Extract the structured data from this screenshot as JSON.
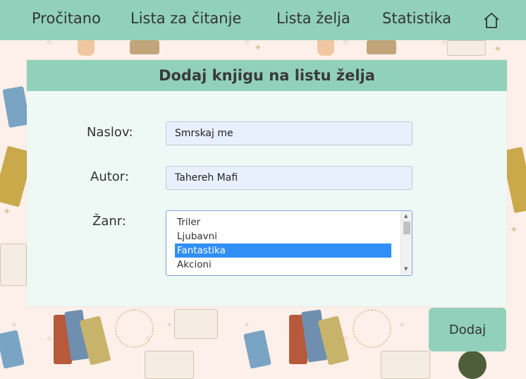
{
  "nav": {
    "items": [
      {
        "label": "Pročitano"
      },
      {
        "label": "Lista za čitanje"
      },
      {
        "label": "Lista želja"
      },
      {
        "label": "Statistika"
      }
    ],
    "home_icon": "home-icon"
  },
  "form": {
    "title": "Dodaj knjigu na listu želja",
    "title_label": "Naslov:",
    "title_value": "Smrskaj me",
    "author_label": "Autor:",
    "author_value": "Tahereh Mafi",
    "genre_label": "Žanr:",
    "genre_options": [
      "Triler",
      "Ljubavni",
      "Fantastika",
      "Akcioni"
    ],
    "genre_selected": "Fantastika",
    "submit_label": "Dodaj"
  },
  "colors": {
    "accent": "#91d1bc",
    "card_bg": "#eef9f6",
    "selected": "#2f8ff6",
    "input_bg": "#e8f0fd"
  }
}
